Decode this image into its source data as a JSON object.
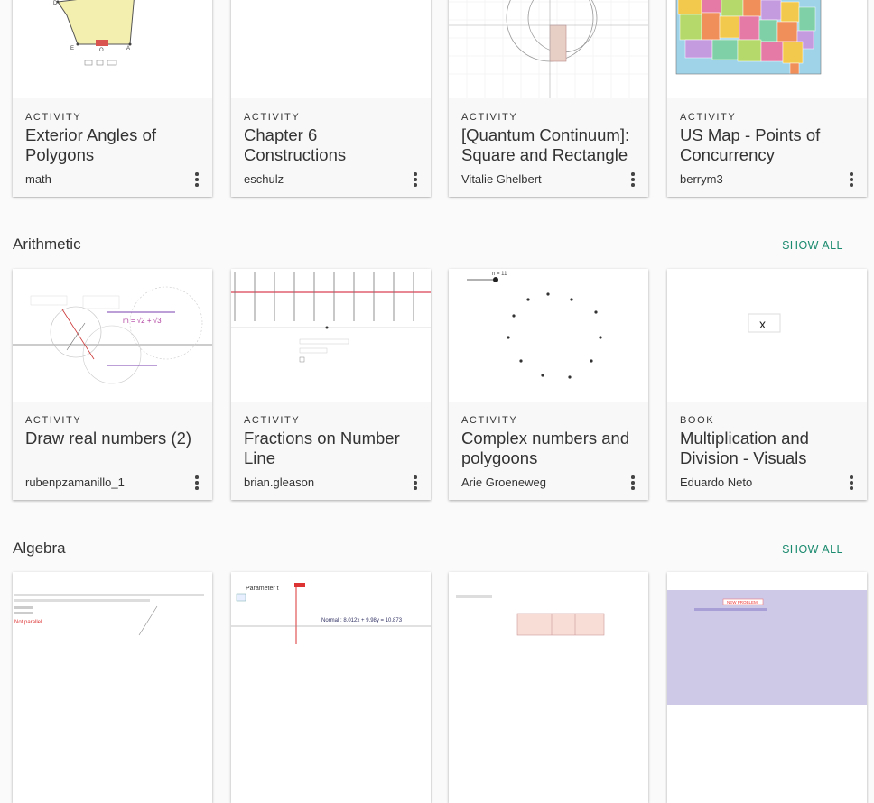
{
  "sections": [
    {
      "title": "",
      "show_all": "",
      "cards": [
        {
          "type": "ACTIVITY",
          "title": "Exterior Angles of Polygons",
          "author": "math",
          "thumb_labels": [
            "D",
            "E",
            "A",
            "O"
          ]
        },
        {
          "type": "ACTIVITY",
          "title": "Chapter 6 Constructions",
          "author": "eschulz"
        },
        {
          "type": "ACTIVITY",
          "title": "[Quantum Continuum]: Square and Rectangle",
          "author": "Vitalie Ghelbert"
        },
        {
          "type": "ACTIVITY",
          "title": "US Map - Points of Concurrency",
          "author": "berrym3"
        }
      ]
    },
    {
      "title": "Arithmetic",
      "show_all": "SHOW ALL",
      "cards": [
        {
          "type": "ACTIVITY",
          "title": "Draw real numbers (2)",
          "author": "rubenpzamanillo_1",
          "thumb_labels": [
            "m = √2 + √3"
          ]
        },
        {
          "type": "ACTIVITY",
          "title": "Fractions on Number Line",
          "author": "brian.gleason"
        },
        {
          "type": "ACTIVITY",
          "title": "Complex numbers and polygoons",
          "author": "Arie Groeneweg",
          "thumb_labels": [
            "n = 11"
          ]
        },
        {
          "type": "BOOK",
          "title": "Multiplication and Division - Visuals",
          "author": "Eduardo Neto",
          "thumb_labels": [
            "x"
          ]
        }
      ]
    },
    {
      "title": "Algebra",
      "show_all": "SHOW ALL",
      "cards": [
        {
          "type": "",
          "title": "",
          "author": "",
          "thumb_labels": [
            "Not parallel"
          ]
        },
        {
          "type": "",
          "title": "",
          "author": "",
          "thumb_labels": [
            "Parameter t",
            "Normal : 8.012x + 9.98y = 10.873"
          ]
        },
        {
          "type": "",
          "title": "",
          "author": ""
        },
        {
          "type": "",
          "title": "",
          "author": "",
          "thumb_labels": [
            "NEW PROBLEM"
          ]
        }
      ]
    }
  ],
  "colors": {
    "accent": "#1a8a6e",
    "card_meta_bg": "#f8f8f8",
    "page_bg": "#fafafa"
  }
}
